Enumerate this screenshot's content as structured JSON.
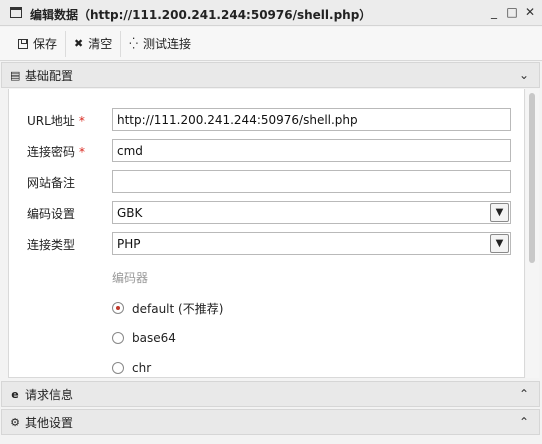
{
  "window": {
    "title": "编辑数据（http://111.200.241.244:50976/shell.php）",
    "minimize": "_",
    "maximize": "□",
    "close": "✕"
  },
  "toolbar": {
    "save_label": "保存",
    "clear_label": "清空",
    "test_label": "测试连接"
  },
  "sections": {
    "basic": "基础配置",
    "request": "请求信息",
    "other": "其他设置"
  },
  "form": {
    "url_label": "URL地址",
    "url_value": "http://111.200.241.244:50976/shell.php",
    "password_label": "连接密码",
    "password_value": "cmd",
    "note_label": "网站备注",
    "note_value": "",
    "encoding_label": "编码设置",
    "encoding_value": "GBK",
    "type_label": "连接类型",
    "type_value": "PHP",
    "required_mark": "*"
  },
  "encoder": {
    "label": "编码器",
    "options": [
      {
        "label": "default (不推荐)",
        "selected": true
      },
      {
        "label": "base64",
        "selected": false
      },
      {
        "label": "chr",
        "selected": false
      }
    ]
  },
  "icons": {
    "window": "window-icon",
    "save": "save-icon",
    "clear": "x-icon",
    "test": "spinner-icon",
    "basic": "file-icon",
    "request": "ie-icon",
    "other": "gears-icon",
    "chevron": "chevron-icon"
  },
  "colors": {
    "required": "#d9281f",
    "radio_selected": "#c0392b"
  }
}
